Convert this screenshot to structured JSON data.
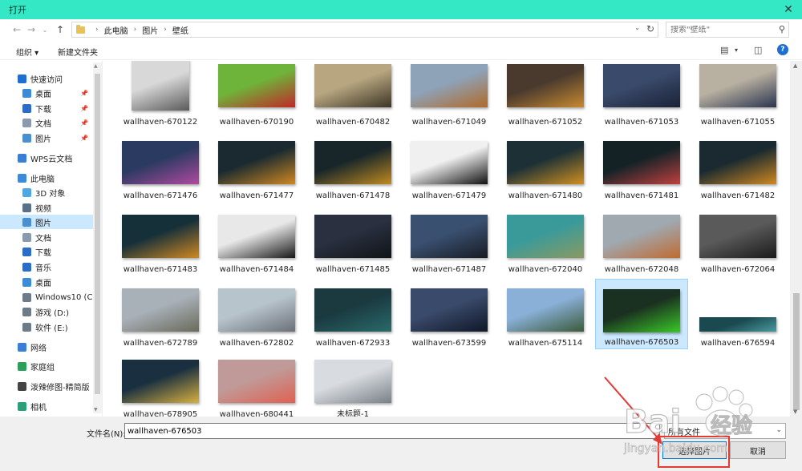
{
  "window": {
    "title": "打开"
  },
  "address": {
    "path": [
      "此电脑",
      "图片",
      "壁纸"
    ]
  },
  "search": {
    "placeholder": "搜索\"壁纸\""
  },
  "toolbar": {
    "organize": "组织 ▾",
    "new_folder": "新建文件夹"
  },
  "sidebar": {
    "items": [
      {
        "label": "快速访问",
        "icon": "star-icon",
        "color": "#1e6fd1",
        "pinned": false
      },
      {
        "label": "桌面",
        "icon": "desktop-icon",
        "color": "#3c8bd9",
        "pinned": true
      },
      {
        "label": "下载",
        "icon": "download-icon",
        "color": "#2a6cc8",
        "pinned": true
      },
      {
        "label": "文档",
        "icon": "document-icon",
        "color": "#8a9aae",
        "pinned": true
      },
      {
        "label": "图片",
        "icon": "pictures-icon",
        "color": "#4a90d0",
        "pinned": true
      },
      {
        "label": "WPS云文档",
        "icon": "cloud-icon",
        "color": "#3a7fd5",
        "pinned": false
      },
      {
        "label": "此电脑",
        "icon": "computer-icon",
        "color": "#3c8bd9",
        "pinned": false
      },
      {
        "label": "3D 对象",
        "icon": "3d-objects-icon",
        "color": "#4fa6e0",
        "pinned": false
      },
      {
        "label": "视频",
        "icon": "video-icon",
        "color": "#5a6f8a",
        "pinned": false
      },
      {
        "label": "图片",
        "icon": "pictures-icon",
        "color": "#4a90d0",
        "pinned": false
      },
      {
        "label": "文档",
        "icon": "document-icon",
        "color": "#8a9aae",
        "pinned": false
      },
      {
        "label": "下载",
        "icon": "download-icon",
        "color": "#2a6cc8",
        "pinned": false
      },
      {
        "label": "音乐",
        "icon": "music-icon",
        "color": "#2a6cc8",
        "pinned": false
      },
      {
        "label": "桌面",
        "icon": "desktop-icon",
        "color": "#3c8bd9",
        "pinned": false
      },
      {
        "label": "Windows10 (C:",
        "icon": "drive-icon",
        "color": "#6d7a88",
        "pinned": false
      },
      {
        "label": "游戏 (D:)",
        "icon": "drive-icon",
        "color": "#6d7a88",
        "pinned": false
      },
      {
        "label": "软件 (E:)",
        "icon": "drive-icon",
        "color": "#6d7a88",
        "pinned": false
      },
      {
        "label": "网络",
        "icon": "network-icon",
        "color": "#3a7fd5",
        "pinned": false
      },
      {
        "label": "家庭组",
        "icon": "homegroup-icon",
        "color": "#2aa05a",
        "pinned": false
      },
      {
        "label": "泼辣修图-精简版",
        "icon": "app-icon",
        "color": "#444444",
        "pinned": false
      },
      {
        "label": "相机",
        "icon": "camera-icon",
        "color": "#2aa07a",
        "pinned": false
      }
    ],
    "selected_index": 9
  },
  "files": [
    {
      "name": "wallhaven-670122",
      "colors": [
        "#d8d8d8",
        "#5a5a5a"
      ]
    },
    {
      "name": "wallhaven-670190",
      "colors": [
        "#6fb43a",
        "#c02828"
      ]
    },
    {
      "name": "wallhaven-670482",
      "colors": [
        "#b7a680",
        "#3c3426"
      ]
    },
    {
      "name": "wallhaven-671049",
      "colors": [
        "#8ea2b8",
        "#b06a28"
      ]
    },
    {
      "name": "wallhaven-671052",
      "colors": [
        "#4a3a2e",
        "#c88a30"
      ]
    },
    {
      "name": "wallhaven-671053",
      "colors": [
        "#3a4a6a",
        "#1a2238"
      ]
    },
    {
      "name": "wallhaven-671055",
      "colors": [
        "#b8b0a0",
        "#2a3450"
      ]
    },
    {
      "name": "wallhaven-671476",
      "colors": [
        "#2a3a60",
        "#b04aa0"
      ]
    },
    {
      "name": "wallhaven-671477",
      "colors": [
        "#1a2a30",
        "#d08820"
      ]
    },
    {
      "name": "wallhaven-671478",
      "colors": [
        "#18262a",
        "#c08a20"
      ]
    },
    {
      "name": "wallhaven-671479",
      "colors": [
        "#f0f0f0",
        "#101010"
      ]
    },
    {
      "name": "wallhaven-671480",
      "colors": [
        "#1c3036",
        "#d09020"
      ]
    },
    {
      "name": "wallhaven-671481",
      "colors": [
        "#142226",
        "#c04040"
      ]
    },
    {
      "name": "wallhaven-671482",
      "colors": [
        "#1a2a30",
        "#d08820"
      ]
    },
    {
      "name": "wallhaven-671483",
      "colors": [
        "#16303a",
        "#d08820"
      ]
    },
    {
      "name": "wallhaven-671484",
      "colors": [
        "#e8e8e8",
        "#181818"
      ]
    },
    {
      "name": "wallhaven-671485",
      "colors": [
        "#2a3040",
        "#101418"
      ]
    },
    {
      "name": "wallhaven-671487",
      "colors": [
        "#3a5070",
        "#181c24"
      ]
    },
    {
      "name": "wallhaven-672040",
      "colors": [
        "#3a9a9a",
        "#8a9a60"
      ]
    },
    {
      "name": "wallhaven-672048",
      "colors": [
        "#a0a8b0",
        "#c06a30"
      ]
    },
    {
      "name": "wallhaven-672064",
      "colors": [
        "#5a5a5a",
        "#1a1a1a"
      ]
    },
    {
      "name": "wallhaven-672789",
      "colors": [
        "#a8b0b8",
        "#6a6a5a"
      ]
    },
    {
      "name": "wallhaven-672802",
      "colors": [
        "#b8c4cc",
        "#6a7078"
      ]
    },
    {
      "name": "wallhaven-672933",
      "colors": [
        "#1a3a40",
        "#2a6a6a"
      ]
    },
    {
      "name": "wallhaven-673599",
      "colors": [
        "#3a4a6a",
        "#101828"
      ]
    },
    {
      "name": "wallhaven-675114",
      "colors": [
        "#8ab0d8",
        "#3a5a3a"
      ]
    },
    {
      "name": "wallhaven-676503",
      "colors": [
        "#1a3020",
        "#3ac828"
      ]
    },
    {
      "name": "wallhaven-676594",
      "colors": [
        "#1a4a50",
        "#4a9aa0"
      ]
    },
    {
      "name": "wallhaven-678905",
      "colors": [
        "#1a3040",
        "#d8b040"
      ]
    },
    {
      "name": "wallhaven-680441",
      "colors": [
        "#c09a98",
        "#e06050"
      ]
    },
    {
      "name": "未标题-1",
      "colors": [
        "#d8dce0",
        "#7a8088"
      ]
    }
  ],
  "selected_file_index": 26,
  "footer": {
    "filename_label": "文件名(N):",
    "filename_value": "wallhaven-676503",
    "filetype": "所有文件",
    "open_button": "选择图片",
    "cancel_button": "取消"
  },
  "watermark": {
    "brand": "Bai",
    "brand2": "经验",
    "url": "jingyan.baidu.com"
  }
}
